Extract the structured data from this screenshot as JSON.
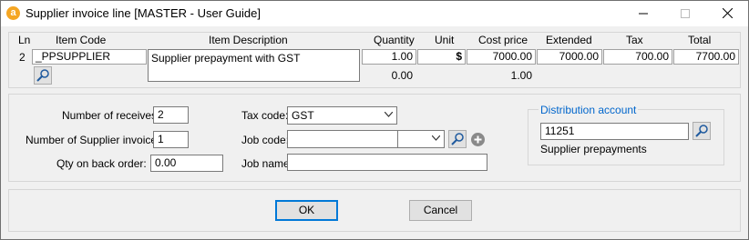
{
  "window": {
    "title": "Supplier invoice line [MASTER - User Guide]"
  },
  "grid": {
    "headers": {
      "ln": "Ln",
      "item_code": "Item Code",
      "item_description": "Item Description",
      "quantity": "Quantity",
      "unit": "Unit",
      "cost_price": "Cost price",
      "extended": "Extended",
      "tax": "Tax",
      "total": "Total"
    },
    "row": {
      "ln": "2",
      "item_code": "_PPSUPPLIER",
      "item_description": "Supplier prepayment with GST",
      "quantity": "1.00",
      "unit": "$",
      "cost_price": "7000.00",
      "extended": "7000.00",
      "tax": "700.00",
      "total": "7700.00"
    },
    "totals": {
      "quantity": "0.00",
      "cost_price": "1.00"
    }
  },
  "form": {
    "receives_label": "Number of receives:",
    "receives_value": "2",
    "supplier_invoices_label": "Number of Supplier invoices:",
    "supplier_invoices_value": "1",
    "back_order_label": "Qty on back order:",
    "back_order_value": "0.00",
    "tax_code_label": "Tax code:",
    "tax_code_value": "GST",
    "job_code_label": "Job code:",
    "job_code_value": "",
    "job_name_label": "Job name:",
    "job_name_value": "",
    "distribution_label": "Distribution account",
    "distribution_value": "11251",
    "distribution_name": "Supplier prepayments"
  },
  "buttons": {
    "ok": "OK",
    "cancel": "Cancel"
  }
}
